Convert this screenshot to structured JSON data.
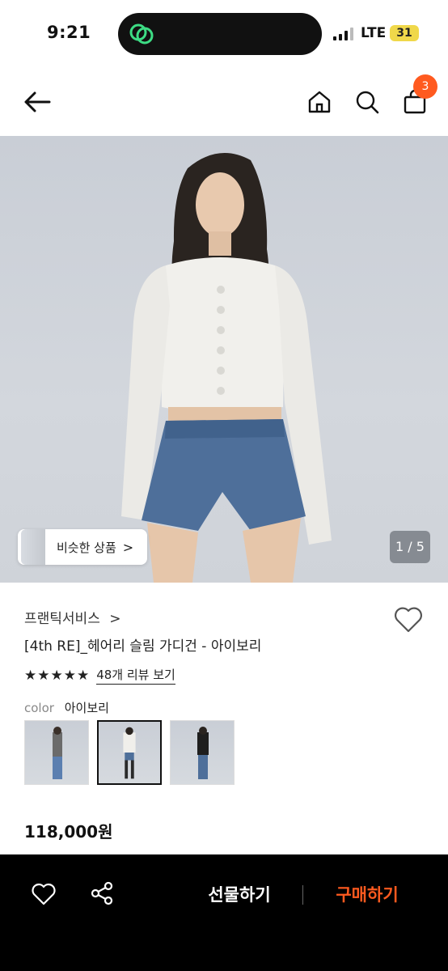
{
  "status_bar": {
    "time": "9:21",
    "network": "LTE",
    "battery": "31"
  },
  "header": {
    "back_icon": "arrow-left-icon",
    "home_icon": "home-icon",
    "search_icon": "search-icon",
    "cart_icon": "shopping-bag-icon",
    "cart_count": "3"
  },
  "gallery": {
    "similar_label": "비슷한 상품",
    "similar_arrow": ">",
    "page_indicator": "1 / 5"
  },
  "product": {
    "brand": "프랜틱서비스",
    "brand_arrow": ">",
    "title": "[4th RE]_헤어리 슬림 가디건 - 아이보리",
    "rating": 4.5,
    "stars_text": "★★★★★",
    "review_link": "48개 리뷰 보기",
    "color_label": "color",
    "color_value": "아이보리",
    "swatches": [
      {
        "name": "grey",
        "selected": false
      },
      {
        "name": "ivory",
        "selected": true
      },
      {
        "name": "black",
        "selected": false
      }
    ],
    "price": "118,000원"
  },
  "bottom_bar": {
    "gift_label": "선물하기",
    "buy_label": "구매하기"
  },
  "colors": {
    "accent": "#ff5a1f",
    "bottom_bar_bg": "#000000",
    "hero_bg": "#cfd3d9"
  }
}
